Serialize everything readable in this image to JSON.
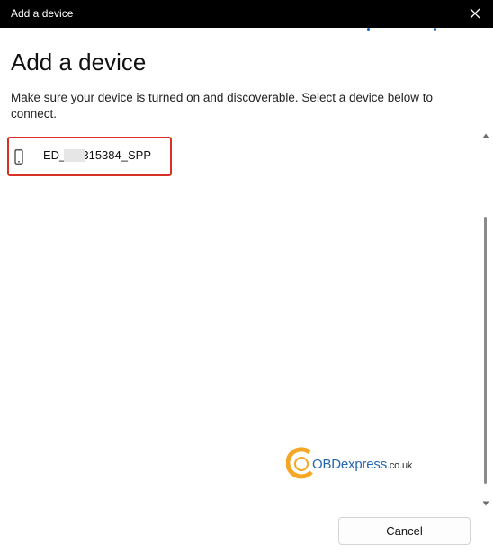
{
  "window": {
    "title": "Add a device"
  },
  "header": {
    "title": "Add a device",
    "description": "Make sure your device is turned on and discoverable. Select a device below to connect."
  },
  "devices": [
    {
      "name": "ED_    30315384_SPP",
      "icon": "phone-icon"
    }
  ],
  "watermark": {
    "brand": "OBDexpress",
    "domain": ".co.uk"
  },
  "footer": {
    "cancel_label": "Cancel"
  },
  "colors": {
    "titlebar": "#000000",
    "highlight": "#d93025",
    "accent": "#0a66c2"
  }
}
